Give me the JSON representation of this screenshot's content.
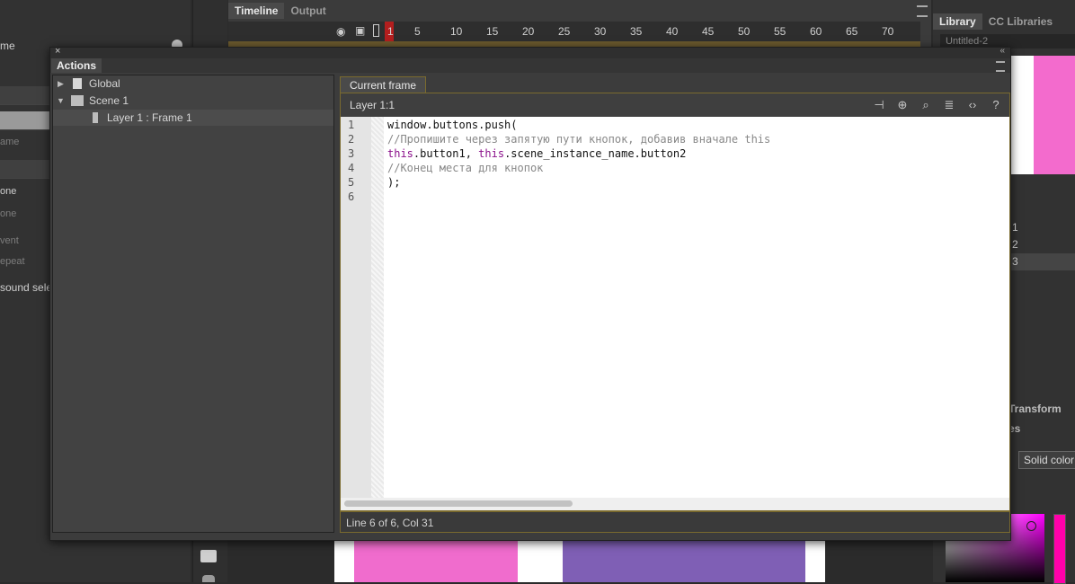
{
  "left_panel": {
    "rows": [
      "me",
      "ame",
      "one",
      "one",
      "vent",
      "epeat",
      " sound sele"
    ]
  },
  "timeline": {
    "tabs": [
      "Timeline",
      "Output"
    ],
    "frames": [
      "1",
      "5",
      "10",
      "15",
      "20",
      "25",
      "30",
      "35",
      "40",
      "45",
      "50",
      "55",
      "60",
      "65",
      "70"
    ]
  },
  "right_panel": {
    "tabs": [
      "Library",
      "CC Libraries"
    ],
    "document": "Untitled-2",
    "items": [
      "1",
      "2",
      "3"
    ],
    "transform_tab": "Transform",
    "es_tab": "es",
    "fill_type": "Solid color"
  },
  "actions": {
    "title": "Actions",
    "tree": [
      {
        "label": "Global",
        "expanded": false
      },
      {
        "label": "Scene 1",
        "expanded": true
      },
      {
        "label": "Layer 1 : Frame 1",
        "selected": true
      }
    ],
    "current_tab": "Current frame",
    "layer_label": "Layer 1:1",
    "code_lines": [
      "window.buttons.push(",
      "//Пропишите через запятую пути кнопок, добавив вначале this",
      "this.button1, this.scene_instance_name.button2",
      "//Конец места для кнопок",
      ");",
      ""
    ],
    "line_numbers": [
      "1",
      "2",
      "3",
      "4",
      "5",
      "6"
    ],
    "code_tokens": {
      "line3_kw1": "this",
      "line3_a": ".button1, ",
      "line3_kw2": "this",
      "line3_b": ".scene_instance_name.button2"
    },
    "status": "Line 6 of 6, Col 31"
  },
  "colors": {
    "pink": "#f06ccd",
    "violet": "#7f5fb5",
    "keyword": "#8a0f8a",
    "comment": "#888888",
    "accent_border": "#7a6a2e"
  }
}
